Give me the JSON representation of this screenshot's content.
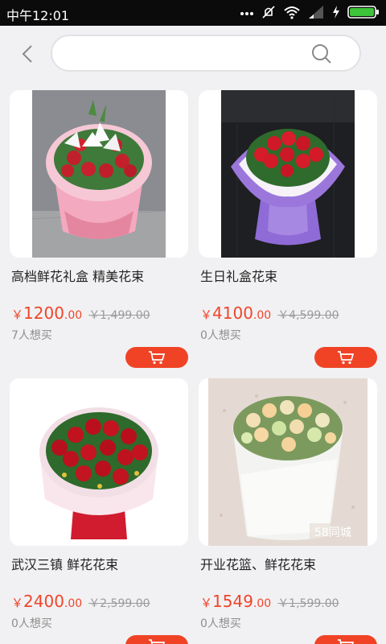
{
  "status_bar": {
    "time": "中午12:01",
    "icons": [
      "mute-icon",
      "wifi-icon",
      "signal-icon",
      "charging-icon",
      "battery-icon"
    ]
  },
  "search": {
    "placeholder": "",
    "value": ""
  },
  "products": [
    {
      "title": "高档鲜花礼盒 精美花束",
      "currency": "￥",
      "price_int": "1200",
      "price_dec": ".00",
      "old_price": "￥1,499.00",
      "want": "7人想买"
    },
    {
      "title": "生日礼盒花束",
      "currency": "￥",
      "price_int": "4100",
      "price_dec": ".00",
      "old_price": "￥4,599.00",
      "want": "0人想买"
    },
    {
      "title": "武汉三镇 鲜花花束",
      "currency": "￥",
      "price_int": "2400",
      "price_dec": ".00",
      "old_price": "￥2,599.00",
      "want": "0人想买"
    },
    {
      "title": "开业花篮、鲜花花束",
      "currency": "￥",
      "price_int": "1549",
      "price_dec": ".00",
      "old_price": "￥1,599.00",
      "want": "0人想买"
    }
  ],
  "colors": {
    "accent": "#f04326",
    "price": "#f0452a",
    "background": "#f1f1f3"
  }
}
